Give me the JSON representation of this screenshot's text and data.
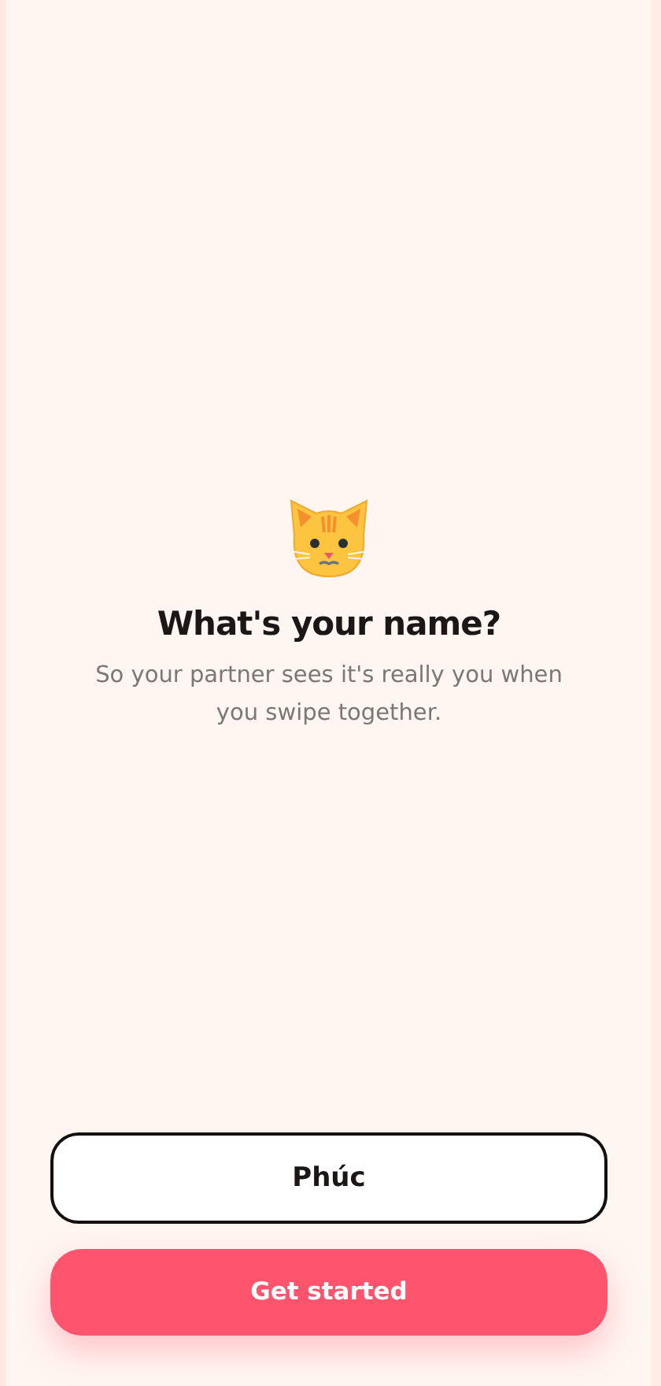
{
  "heading": "What's your name?",
  "subtitle": "So your partner sees it's really you when you swipe together.",
  "name_field": {
    "value": "Phúc"
  },
  "button": {
    "label": "Get started"
  }
}
